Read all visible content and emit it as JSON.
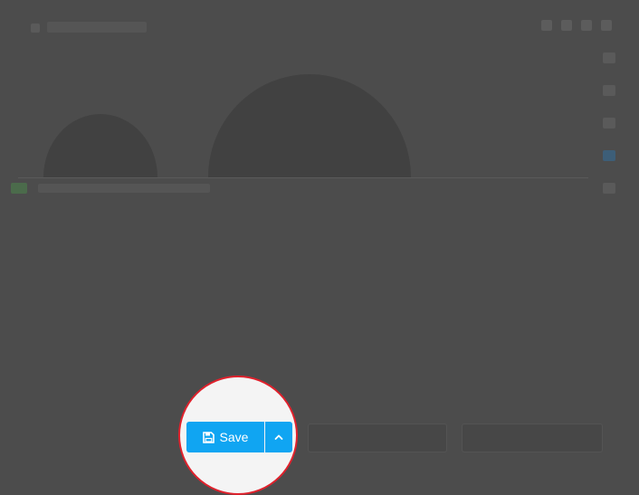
{
  "footer": {
    "save_label": "Save"
  },
  "icons": {
    "save": "floppy-disk-icon",
    "expand": "chevron-up-icon"
  },
  "colors": {
    "overlay": "#4c4c4c",
    "spotlight_ring": "#e0212c",
    "primary_button": "#10a5f2"
  }
}
